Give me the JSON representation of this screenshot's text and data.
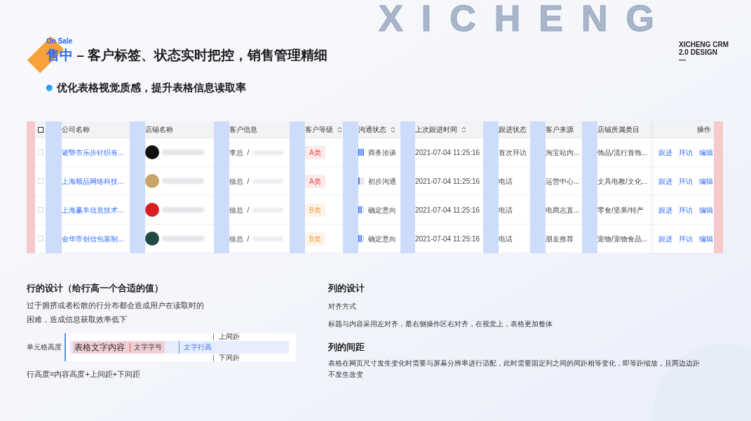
{
  "background_title": "XICHENG",
  "brand": {
    "line1": "XICHENG CRM",
    "line2": "2.0 DESIGN",
    "mark": "—"
  },
  "header": {
    "tag": "On Sale",
    "highlight": "售中",
    "title": " – 客户标签、状态实时把控，销售管理精细"
  },
  "subtitle": "优化表格视觉质感，提升表格信息读取率",
  "table": {
    "header_checkbox": {
      "checked": false
    },
    "columns": [
      {
        "label": "公司名称",
        "sortable": false
      },
      {
        "label": "店铺名称",
        "sortable": false
      },
      {
        "label": "客户信息",
        "sortable": false
      },
      {
        "label": "客户等级",
        "sortable": true
      },
      {
        "label": "沟通状态",
        "sortable": true
      },
      {
        "label": "上次跟进时间",
        "sortable": true
      },
      {
        "label": "跟进状态",
        "sortable": false
      },
      {
        "label": "客户来源",
        "sortable": false
      },
      {
        "label": "店铺所属类目",
        "sortable": false
      },
      {
        "label": "操作",
        "sortable": false
      }
    ],
    "rows": [
      {
        "checked": false,
        "company": "诸暨市乐步针织有...",
        "logo": {
          "color": "#111111"
        },
        "contact": "李总  /",
        "grade": {
          "label": "A类",
          "color": "#e5484d"
        },
        "comm": {
          "kind": "high",
          "label": "商务洽谈"
        },
        "time": "2021-07-04 11:25:16",
        "follow": "首次拜访",
        "source": "淘宝站内...",
        "category": "饰品/流行首饰...",
        "actions": [
          "跟进",
          "拜访",
          "编辑"
        ]
      },
      {
        "checked": false,
        "company": "上海顺品网络科技...",
        "logo": {
          "color": "#c9a46a"
        },
        "contact": "徐总  /",
        "grade": {
          "label": "A类",
          "color": "#e5484d"
        },
        "comm": {
          "kind": "low",
          "label": "初步沟通"
        },
        "time": "2021-07-04 11:25:16",
        "follow": "电话",
        "source": "运营中心...",
        "category": "文具电教/文化...",
        "actions": [
          "跟进",
          "拜访",
          "编辑"
        ]
      },
      {
        "checked": false,
        "company": "上海赢丰信息技术...",
        "logo": {
          "color": "#d81e1e"
        },
        "contact": "徐总  /",
        "grade": {
          "label": "B类",
          "color": "#f59a3c"
        },
        "comm": {
          "kind": "mid",
          "label": "确定意向"
        },
        "time": "2021-07-04 11:25:16",
        "follow": "电话",
        "source": "电商志直...",
        "category": "零食/坚果/特产",
        "actions": [
          "跟进",
          "拜访",
          "编辑"
        ]
      },
      {
        "checked": false,
        "company": "金华市创信包装制...",
        "logo": {
          "color": "#1f4a44"
        },
        "contact": "徐总  /",
        "grade": {
          "label": "B类",
          "color": "#f59a3c"
        },
        "comm": {
          "kind": "mid",
          "label": "确定意向"
        },
        "time": "2021-07-04 11:25:16",
        "follow": "电话",
        "source": "朋友推荐",
        "category": "宠物/宠物食品...",
        "actions": [
          "跟进",
          "拜访",
          "编辑"
        ]
      }
    ]
  },
  "row_design": {
    "heading": "行的设计（给行高一个合适的值）",
    "text": "过于拥挤或者松散的行分布都会造成用户在读取时的困难，造成信息获取效率低下",
    "diagram": {
      "cell_height": "单元格高度",
      "sample": "表格文字内容",
      "font_size": "文字字号",
      "line_height": "文字行高",
      "top": "上间距",
      "bottom": "下间距"
    },
    "formula": "行高度=内容高度+上间距+下间距"
  },
  "column_design": {
    "heading": "列的设计",
    "subheading": "对齐方式",
    "text": "标题与内容采用左对齐，最右侧操作区右对齐，在视觉上，表格更加整体"
  },
  "column_spacing": {
    "heading": "列的间距",
    "text": "表格在网页尺寸发生变化时需要与屏幕分辨率进行适配，此时需要固定列之间的间距相等变化，即等距缩放，且两边边距不发生改变"
  }
}
